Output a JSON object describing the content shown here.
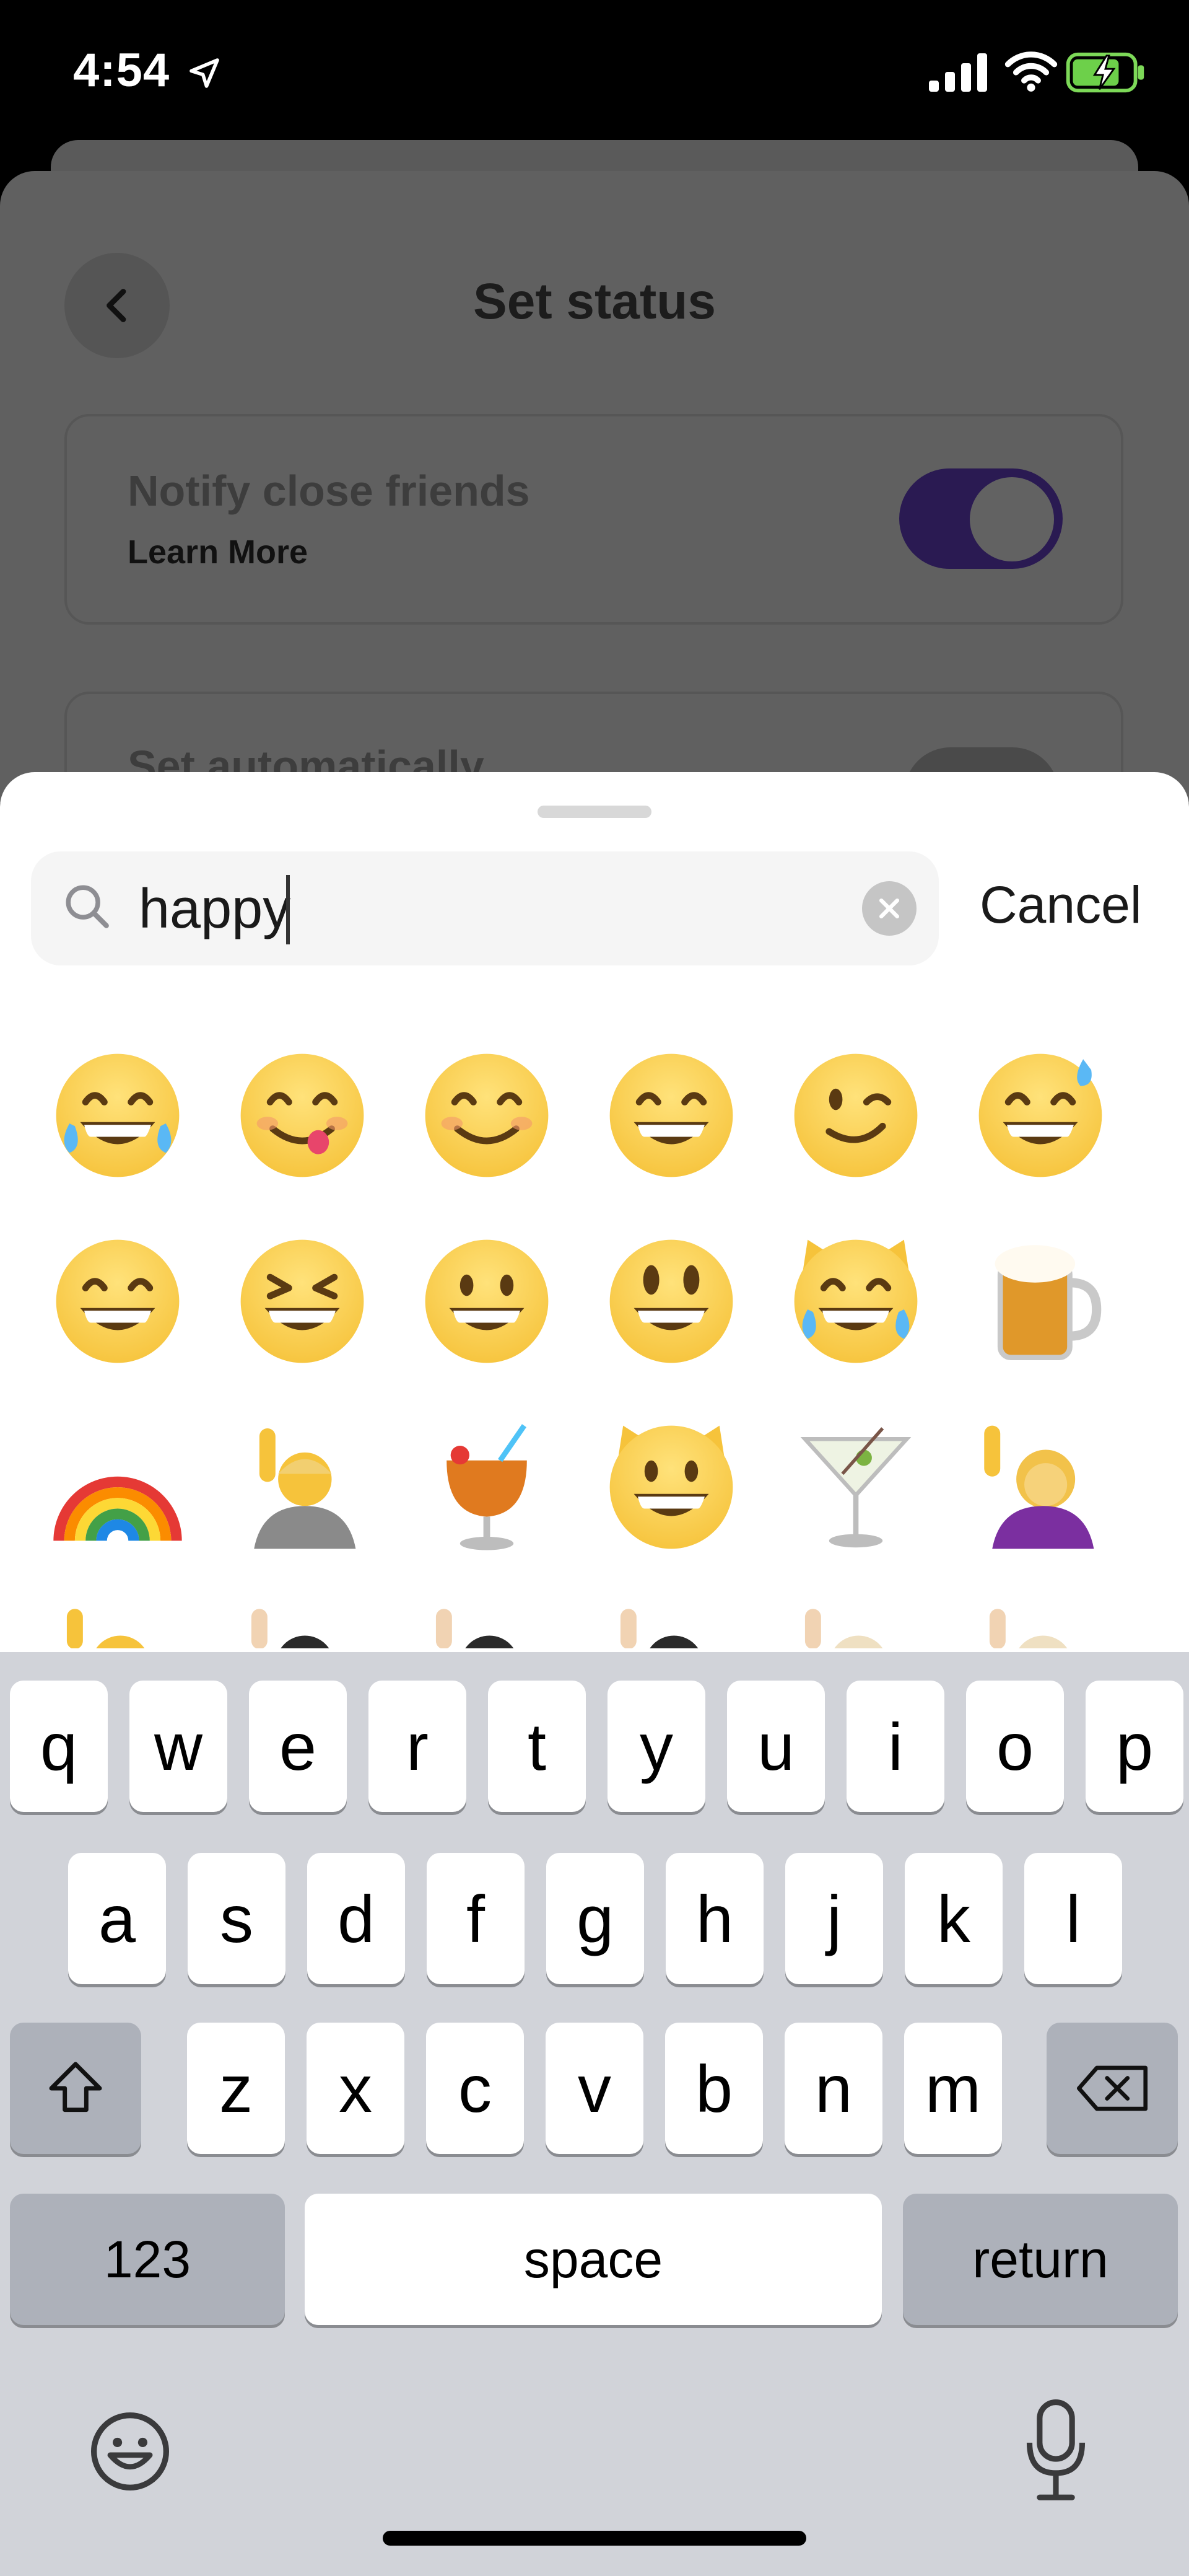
{
  "status_bar": {
    "time": "4:54",
    "icons": [
      "location-arrow-icon",
      "cellular-signal-icon",
      "wifi-icon",
      "battery-charging-icon"
    ]
  },
  "background_screen": {
    "title": "Set status",
    "notify_label": "Notify close friends",
    "learn_more": "Learn More",
    "notify_toggle_on": true,
    "auto_label": "Set automatically",
    "auto_toggle_on": false
  },
  "emoji_picker": {
    "search": {
      "value": "happy",
      "placeholder": "Search"
    },
    "cancel_label": "Cancel",
    "emojis": [
      [
        "face-with-tears-of-joy",
        "face-savoring-food",
        "smiling-face-with-smiling-eyes",
        "beaming-face-with-smiling-eyes",
        "winking-face",
        "grinning-face-with-sweat"
      ],
      [
        "grinning-face-with-smiling-eyes",
        "grinning-squinting-face",
        "grinning-face",
        "grinning-face-with-big-eyes",
        "cat-with-tears-of-joy",
        "beer-mug"
      ],
      [
        "rainbow",
        "person-raising-hand",
        "tropical-drink",
        "grinning-cat",
        "cocktail-glass",
        "woman-raising-hand"
      ]
    ]
  },
  "keyboard": {
    "row1": [
      "q",
      "w",
      "e",
      "r",
      "t",
      "y",
      "u",
      "i",
      "o",
      "p"
    ],
    "row2": [
      "a",
      "s",
      "d",
      "f",
      "g",
      "h",
      "j",
      "k",
      "l"
    ],
    "row3": [
      "z",
      "x",
      "c",
      "v",
      "b",
      "n",
      "m"
    ],
    "numbers_label": "123",
    "space_label": "space",
    "return_label": "return"
  },
  "colors": {
    "toggle_on": "#4a2c8f",
    "accent_emoji": "#f6c33b"
  }
}
